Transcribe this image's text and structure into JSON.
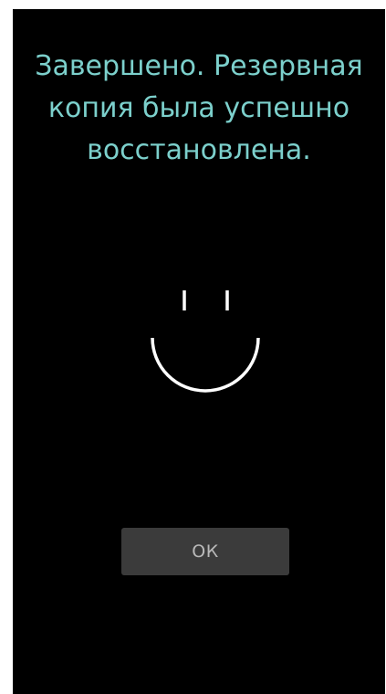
{
  "dialog": {
    "message_lines": [
      "Завершено. Резервная",
      "копия была успешно",
      "восстановлена."
    ],
    "ok_label": "ОК"
  },
  "colors": {
    "background": "#000000",
    "message_text": "#7cd0cc",
    "smiley_stroke": "#ffffff",
    "button_bg": "#3b3b3b",
    "button_text": "#b9b9b9"
  },
  "icons": {
    "status": "smiley-face-icon"
  }
}
